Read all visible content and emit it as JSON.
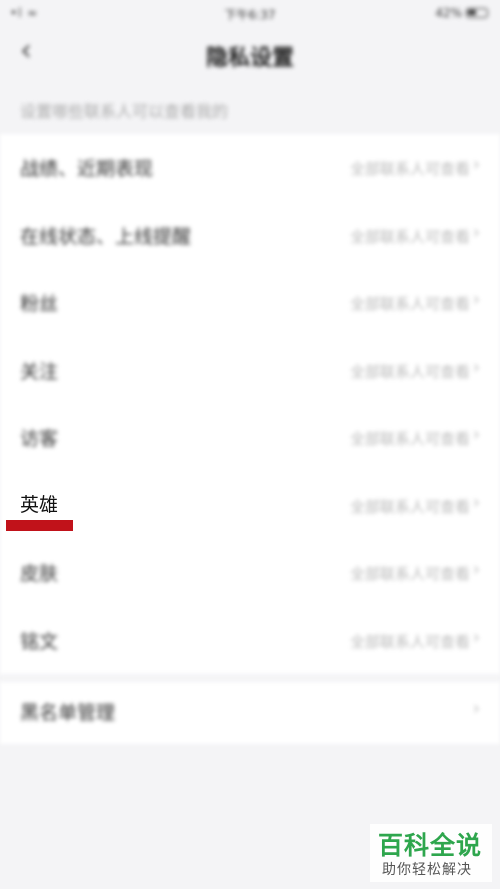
{
  "status_bar": {
    "signal": "•l ≈",
    "time": "下午6:37",
    "battery_percent": "42%"
  },
  "nav": {
    "back_icon": "chevron-left-icon",
    "title": "隐私设置"
  },
  "section_hint": "设置哪些联系人可以查看我的",
  "rows": [
    {
      "label": "战绩、近期表现",
      "value": "全部联系人可查看"
    },
    {
      "label": "在线状态、上线提醒",
      "value": "全部联系人可查看"
    },
    {
      "label": "粉丝",
      "value": "全部联系人可查看"
    },
    {
      "label": "关注",
      "value": "全部联系人可查看"
    },
    {
      "label": "访客",
      "value": "全部联系人可查看"
    },
    {
      "label": "英雄",
      "value": "全部联系人可查看"
    },
    {
      "label": "皮肤",
      "value": "全部联系人可查看"
    },
    {
      "label": "铭文",
      "value": "全部联系人可查看"
    }
  ],
  "blacklist": {
    "label": "黑名单管理"
  },
  "highlight": {
    "label": "英雄",
    "underline_color": "#c1121a"
  },
  "watermark": {
    "title": "百科全说",
    "subtitle": "助你轻松解决",
    "color": "#2ea64d"
  }
}
